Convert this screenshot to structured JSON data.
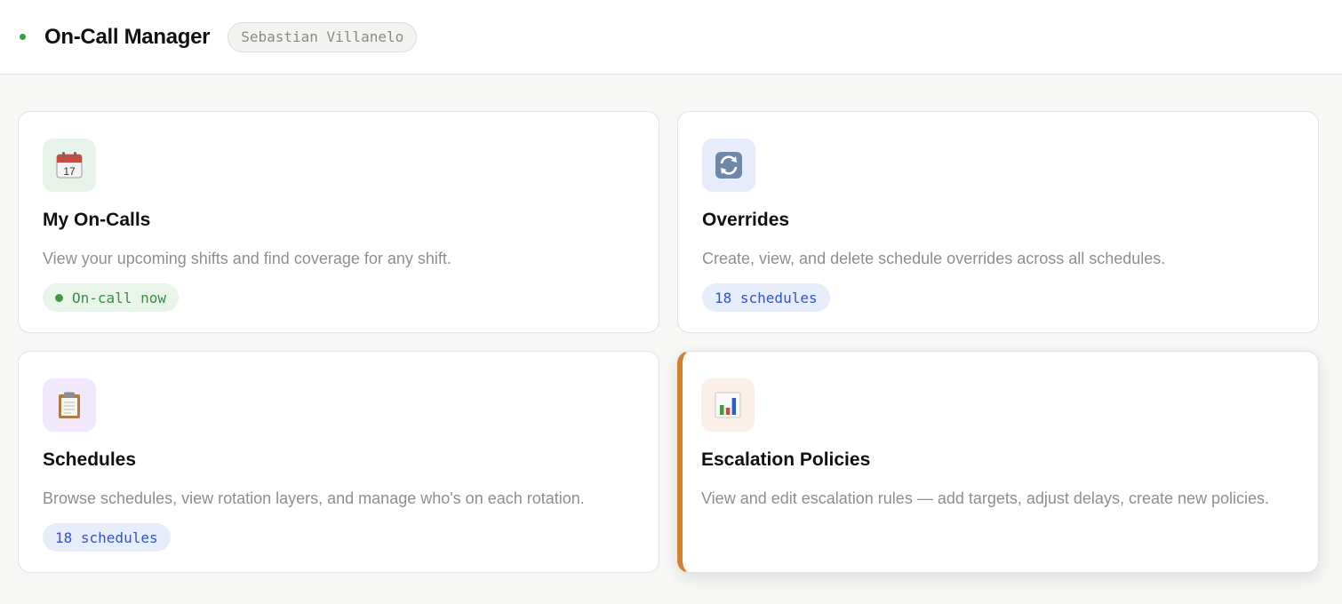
{
  "header": {
    "title": "On-Call Manager",
    "user": "Sebastian Villanelo",
    "status_color": "#3d9a45"
  },
  "cards": [
    {
      "icon": "calendar-icon",
      "title": "My On-Calls",
      "description": "View your upcoming shifts and find coverage for any shift.",
      "badge": "On-call now"
    },
    {
      "icon": "refresh-icon",
      "title": "Overrides",
      "description": "Create, view, and delete schedule overrides across all schedules.",
      "badge": "18 schedules"
    },
    {
      "icon": "clipboard-icon",
      "title": "Schedules",
      "description": "Browse schedules, view rotation layers, and manage who's on each rotation.",
      "badge": "18 schedules"
    },
    {
      "icon": "bar-chart-icon",
      "title": "Escalation Policies",
      "description": "View and edit escalation rules — add targets, adjust delays, create new policies.",
      "accent_color": "#d0822f"
    }
  ]
}
